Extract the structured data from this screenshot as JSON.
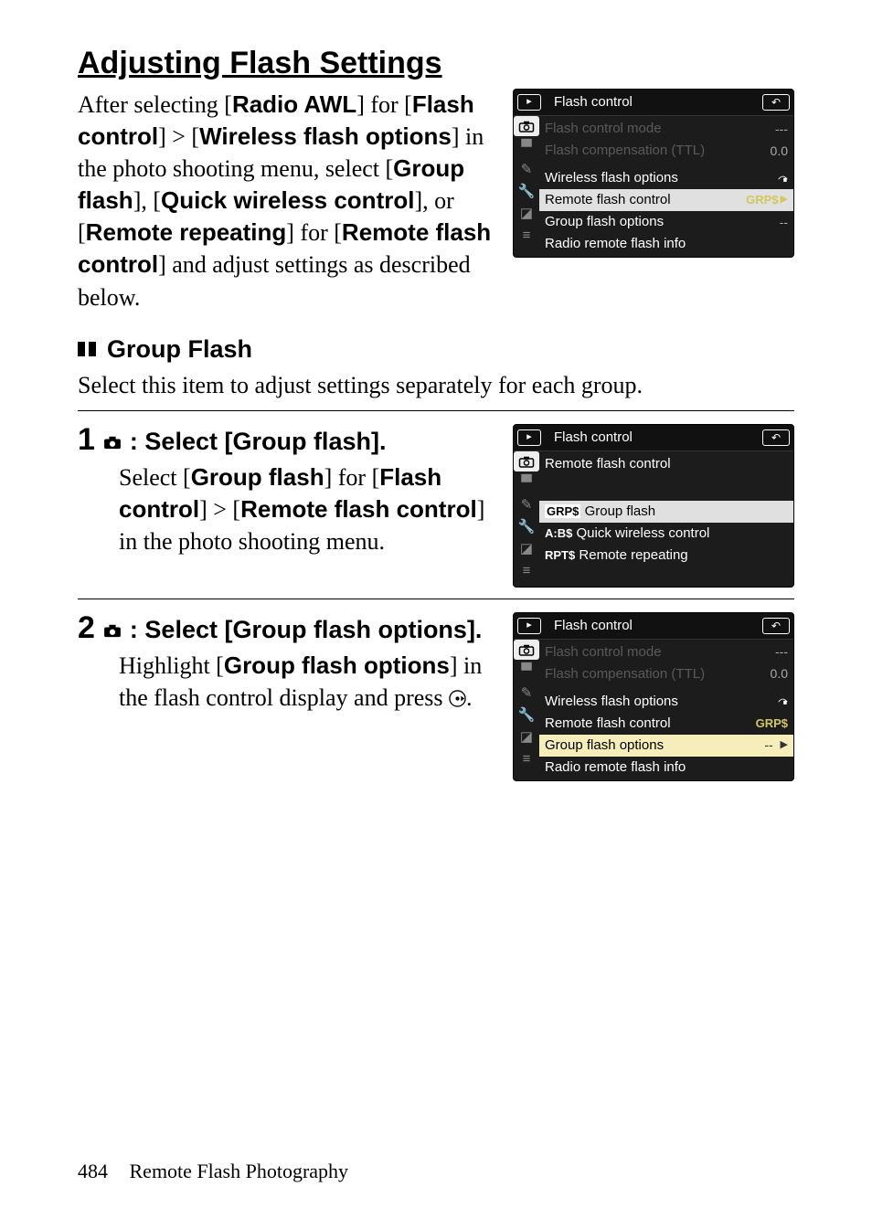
{
  "title": "Adjusting Flash Settings",
  "para1": {
    "t1": "After selecting [",
    "b1": "Radio AWL",
    "t2": "] for [",
    "b2": "Flash control",
    "t3": "] > [",
    "b3": "Wireless flash options",
    "t4": "] in the photo shooting menu, select [",
    "b4": "Group flash",
    "t5": "], [",
    "b5": "Quick wireless control",
    "t6": "], or [",
    "b6": "Remote repeating",
    "t7": "] for [",
    "b7": "Remote flash control",
    "t8": "] and adjust settings as described below."
  },
  "subhead": "Group Flash",
  "subintro": "Select this item to adjust settings separately for each group.",
  "step1": {
    "num": "1",
    "camglyph": "camera-icon",
    "title": ": Select [Group flash].",
    "t1": "Select [",
    "b1": "Group flash",
    "t2": "] for [",
    "b2": "Flash control",
    "t3": "] > [",
    "b3": "Remote flash control",
    "t4": "] in the photo shooting menu."
  },
  "step2": {
    "num": "2",
    "camglyph": "camera-icon",
    "title": ": Select [Group flash options].",
    "t1": "Highlight [",
    "b1": "Group flash options",
    "t2": "] in the flash control display and press ",
    "t3": "."
  },
  "screen1": {
    "title": "Flash control",
    "rows": [
      {
        "label": "Flash control mode",
        "val": "---",
        "dim": true
      },
      {
        "label": "Flash compensation (TTL)",
        "val": "0.0",
        "dim": true
      },
      {
        "label": "Wireless flash options",
        "val": "wireless-icon"
      },
      {
        "label": "Remote flash control",
        "val": "GRP$",
        "sel": true,
        "arrow": true
      },
      {
        "label": "Group flash options",
        "val": "--"
      },
      {
        "label": "Radio remote flash info",
        "val": ""
      }
    ]
  },
  "screen2": {
    "title": "Flash control",
    "sub": "Remote flash control",
    "rows": [
      {
        "mode": "GRP$",
        "label": "Group flash",
        "sel": true
      },
      {
        "mode": "A:B$",
        "label": "Quick wireless control"
      },
      {
        "mode": "RPT$",
        "label": "Remote repeating"
      }
    ]
  },
  "screen3": {
    "title": "Flash control",
    "rows": [
      {
        "label": "Flash control mode",
        "val": "---",
        "dim": true
      },
      {
        "label": "Flash compensation (TTL)",
        "val": "0.0",
        "dim": true
      },
      {
        "label": "Wireless flash options",
        "val": "wireless-icon"
      },
      {
        "label": "Remote flash control",
        "val": "GRP$"
      },
      {
        "label": "Group flash options",
        "val": "--",
        "hi": true,
        "arrow": true
      },
      {
        "label": "Radio remote flash info",
        "val": ""
      }
    ]
  },
  "footer": {
    "page": "484",
    "chapter": "Remote Flash Photography"
  }
}
